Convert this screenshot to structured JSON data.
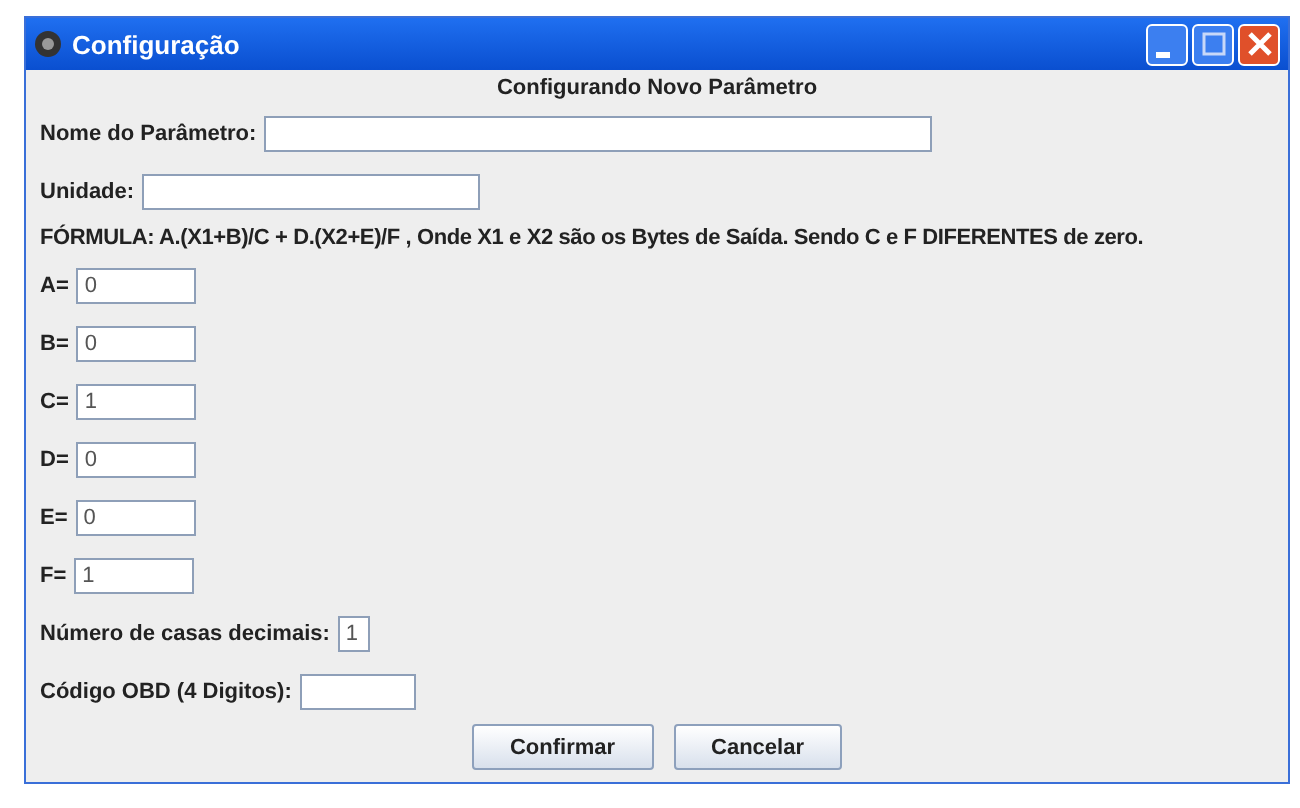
{
  "window": {
    "title": "Configuração"
  },
  "heading": "Configurando Novo Parâmetro",
  "top_fields": [
    {
      "kind": "name",
      "label": "Nome do Parâmetro:"
    },
    {
      "kind": "unit",
      "label": "Unidade:"
    }
  ],
  "formula": "FÓRMULA:  A.(X1+B)/C  +  D.(X2+E)/F  , Onde X1 e X2 são os Bytes de Saída. Sendo C e F DIFERENTES de zero.",
  "coefficients": [
    {
      "label": "A=",
      "value": "0"
    },
    {
      "label": "B=",
      "value": "0"
    },
    {
      "label": "C=",
      "value": "1"
    },
    {
      "label": "D=",
      "value": "0"
    },
    {
      "label": "E=",
      "value": "0"
    },
    {
      "label": "F=",
      "value": "1"
    }
  ],
  "bottom_fields": [
    {
      "kind": "decimals",
      "label": "Número de casas decimais:",
      "value": "1"
    },
    {
      "kind": "code",
      "label": "Código OBD (4 Digitos):"
    }
  ],
  "buttons": [
    "Confirmar",
    "Cancelar"
  ]
}
